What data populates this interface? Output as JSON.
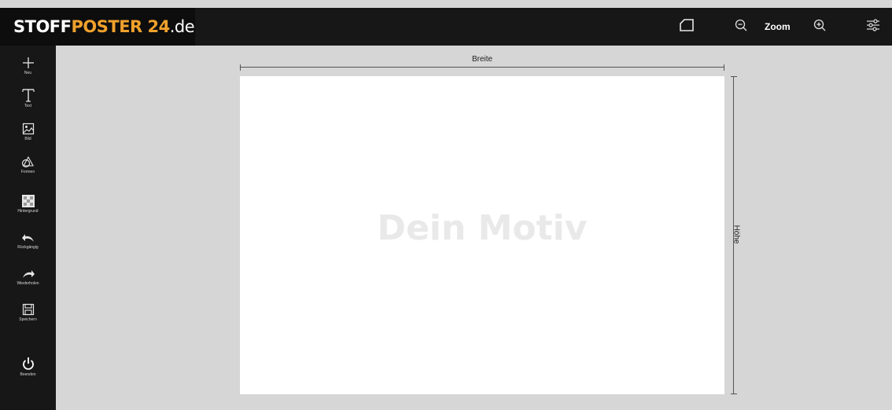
{
  "brand": {
    "part1": "STOFF",
    "part2": "POSTER 24",
    "part3": ".de",
    "accent_color": "#f0a12c"
  },
  "topbar": {
    "format_icon": "page-format-icon",
    "zoom_out_icon": "zoom-out-icon",
    "zoom_label": "Zoom",
    "zoom_in_icon": "zoom-in-icon",
    "settings_icon": "sliders-icon"
  },
  "sidebar": {
    "items": [
      {
        "label": "Neu",
        "icon": "plus-icon"
      },
      {
        "label": "Text",
        "icon": "text-icon"
      },
      {
        "label": "Bild",
        "icon": "image-icon"
      },
      {
        "label": "Formen",
        "icon": "shapes-icon"
      },
      {
        "label": "Hintergrund",
        "icon": "background-icon"
      },
      {
        "label": "Rückgängig",
        "icon": "undo-icon"
      },
      {
        "label": "Wiederholen",
        "icon": "redo-icon"
      },
      {
        "label": "Speichern",
        "icon": "save-icon"
      },
      {
        "label": "Beenden",
        "icon": "power-icon"
      }
    ]
  },
  "canvas": {
    "placeholder": "Dein Motiv",
    "width_label": "Breite",
    "height_label": "Höhe"
  }
}
